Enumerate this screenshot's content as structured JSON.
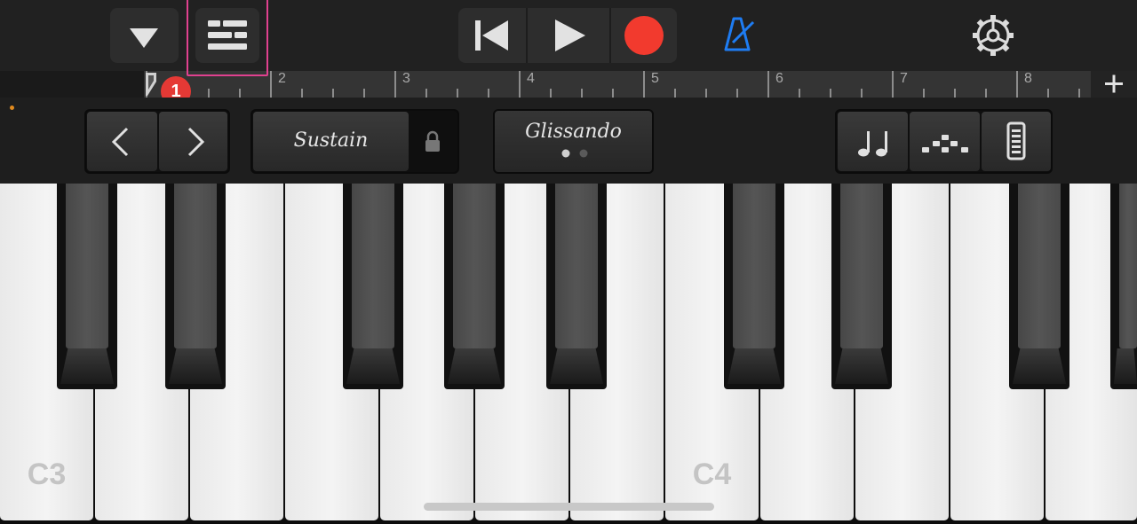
{
  "toolbar": {
    "metronome_color": "#1e7cf2",
    "record_color": "#f23a2e"
  },
  "annotation": {
    "badge": "1",
    "highlight_color": "#e0418f"
  },
  "ruler": {
    "bars": [
      "2",
      "3",
      "4",
      "5",
      "6",
      "7",
      "8"
    ],
    "add_label": "+"
  },
  "controls": {
    "sustain_label": "Sustain",
    "glissando_label": "Glissando"
  },
  "keyboard": {
    "labels": {
      "c3": "C3",
      "c4": "C4"
    }
  },
  "icons": {
    "menu": "triangle-down-icon",
    "tracks": "tracks-view-icon",
    "rewind": "go-to-beginning-icon",
    "play": "play-icon",
    "record": "record-icon",
    "metronome": "metronome-icon",
    "settings": "gear-icon",
    "lock": "lock-icon",
    "chord": "notes-icon",
    "arpeggiator": "arpeggiator-icon",
    "velocity": "velocity-icon"
  }
}
